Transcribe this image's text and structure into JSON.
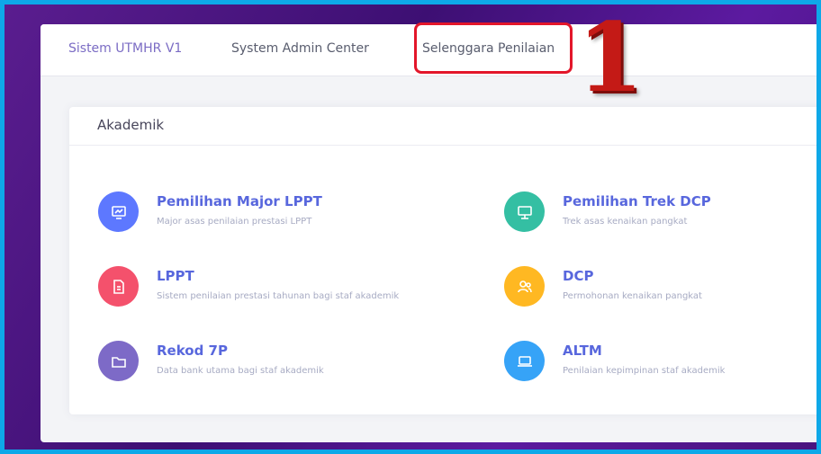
{
  "nav": {
    "brand": "Sistem UTMHR V1",
    "admin_center": "System Admin Center",
    "selenggara": "Selenggara Penilaian"
  },
  "annotation": {
    "step": "1",
    "color": "#e3162a"
  },
  "section": {
    "title": "Akademik"
  },
  "items": [
    {
      "title": "Pemilihan Major LPPT",
      "desc": "Major asas penilaian prestasi LPPT",
      "icon": "monitor-chart-icon",
      "color": "#5d78ff"
    },
    {
      "title": "Pemilihan Trek DCP",
      "desc": "Trek asas kenaikan pangkat",
      "icon": "presentation-icon",
      "color": "#34bfa3"
    },
    {
      "title": "LPPT",
      "desc": "Sistem penilaian prestasi tahunan bagi staf akademik",
      "icon": "document-icon",
      "color": "#f4516c"
    },
    {
      "title": "DCP",
      "desc": "Permohonan kenaikan pangkat",
      "icon": "users-icon",
      "color": "#ffb822"
    },
    {
      "title": "Rekod 7P",
      "desc": "Data bank utama bagi staf akademik",
      "icon": "folder-icon",
      "color": "#7d6ac7"
    },
    {
      "title": "ALTM",
      "desc": "Penilaian kepimpinan staf akademik",
      "icon": "laptop-icon",
      "color": "#36a3f7"
    }
  ]
}
